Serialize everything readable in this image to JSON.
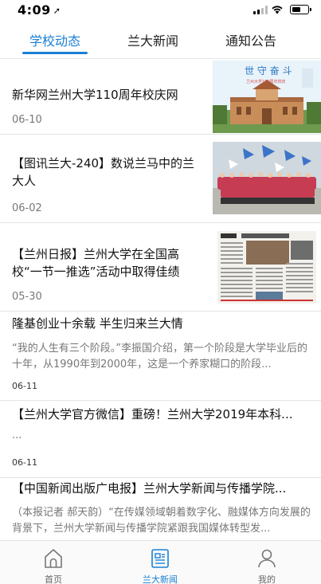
{
  "status_bar": {
    "time": "4:09",
    "location_arrow": "➚"
  },
  "tabs": [
    {
      "label": "学校动态",
      "active": true
    },
    {
      "label": "兰大新闻",
      "active": false
    },
    {
      "label": "通知公告",
      "active": false
    }
  ],
  "news": [
    {
      "title": "新华网兰州大学110周年校庆网",
      "date": "06-10",
      "thumb": "campus-building-photo"
    },
    {
      "title": "【图讯兰大-240】数说兰马中的兰大人",
      "date": "06-02",
      "thumb": "marathon-team-photo"
    },
    {
      "title": "【兰州日报】兰州大学在全国高校“一节一推选”活动中取得佳绩",
      "date": "05-30",
      "thumb": "newspaper-page-photo"
    },
    {
      "title": "隆基创业十余载 半生归来兰大情",
      "summary": "“我的人生有三个阶段。”李振国介绍，第一个阶段是大学毕业后的十年，从1990年到2000年，这是一个养家糊口的阶段...",
      "date": "06-11"
    },
    {
      "title": "【兰州大学官方微信】重磅！兰州大学2019年本科...",
      "summary": "...",
      "date": "06-11"
    },
    {
      "title": "【中国新闻出版广电报】兰州大学新闻与传播学院...",
      "summary": "（本报记者 郝天韵）“在传媒领域朝着数字化、融媒体方向发展的背景下，兰州大学新闻与传播学院紧跟我国媒体转型发..."
    }
  ],
  "thumb_texts": {
    "thumb1_heading": "世 守 奋 斗",
    "thumb1_sub": "兰州大学110周年校庆"
  },
  "bottom_nav": [
    {
      "label": "首页",
      "icon": "home-icon",
      "active": false
    },
    {
      "label": "兰大新闻",
      "icon": "news-icon",
      "active": true
    },
    {
      "label": "我的",
      "icon": "profile-icon",
      "active": false
    }
  ],
  "colors": {
    "accent": "#1a7fd4",
    "text": "#111111",
    "muted": "#777777"
  }
}
